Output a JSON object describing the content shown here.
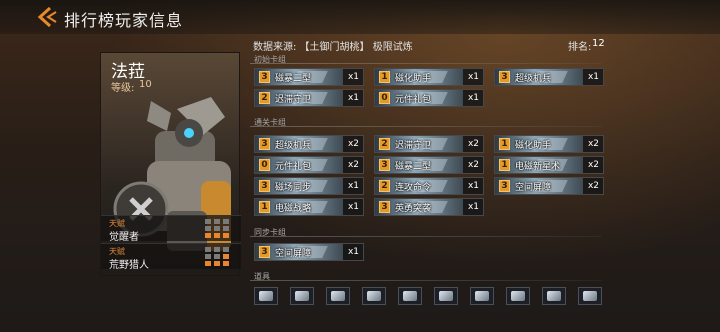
{
  "header": {
    "title": "排行榜玩家信息"
  },
  "character": {
    "name": "法菈",
    "level_label": "等级:",
    "level_value": "10",
    "traits": [
      {
        "label": "天赋",
        "value": "觉醒者",
        "filled": 3
      },
      {
        "label": "天赋",
        "value": "荒野猎人",
        "filled": 4
      }
    ]
  },
  "info": {
    "source": "数据来源: 【土御门胡桃】 极限试炼",
    "rank_label": "排名:",
    "rank_value": "12"
  },
  "sections": {
    "initial": {
      "label": "初始卡组",
      "cards": [
        {
          "cost": "3",
          "name": "磁暴二型",
          "count": "x1"
        },
        {
          "cost": "1",
          "name": "磁化助手",
          "count": "x1"
        },
        {
          "cost": "3",
          "name": "超级机兵",
          "count": "x1"
        },
        {
          "cost": "2",
          "name": "迟滞守卫",
          "count": "x1"
        },
        {
          "cost": "0",
          "name": "元件礼包",
          "count": "x1"
        }
      ]
    },
    "clear": {
      "label": "通关卡组",
      "cards": [
        {
          "cost": "3",
          "name": "超级机兵",
          "count": "x2"
        },
        {
          "cost": "2",
          "name": "迟滞守卫",
          "count": "x2"
        },
        {
          "cost": "1",
          "name": "磁化助手",
          "count": "x2"
        },
        {
          "cost": "0",
          "name": "元件礼包",
          "count": "x2"
        },
        {
          "cost": "3",
          "name": "磁暴二型",
          "count": "x2"
        },
        {
          "cost": "1",
          "name": "电磁新星术",
          "count": "x2"
        },
        {
          "cost": "3",
          "name": "磁场同步",
          "count": "x1"
        },
        {
          "cost": "2",
          "name": "连攻命令",
          "count": "x1"
        },
        {
          "cost": "3",
          "name": "空间屏障",
          "count": "x2"
        },
        {
          "cost": "1",
          "name": "电磁战略",
          "count": "x1"
        },
        {
          "cost": "3",
          "name": "英勇突袭",
          "count": "x1"
        }
      ]
    },
    "sync": {
      "label": "同步卡组",
      "cards": [
        {
          "cost": "3",
          "name": "空间屏障",
          "count": "x1"
        }
      ]
    },
    "items": {
      "label": "道具",
      "count": 10
    }
  },
  "colors": {
    "accent": "#e39a2a",
    "trait_on": "#e9852f",
    "level": "#e6c79a"
  }
}
